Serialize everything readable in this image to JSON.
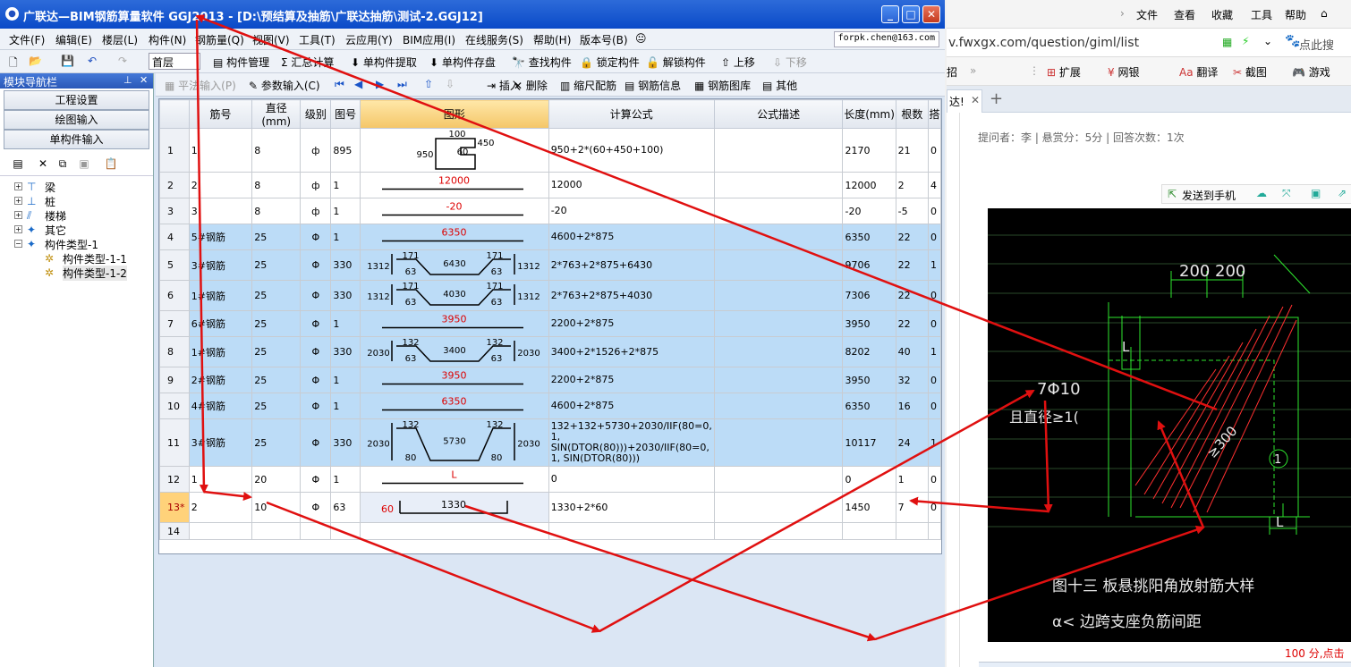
{
  "window": {
    "title": "广联达—BIM钢筋算量软件 GGJ2013 - [D:\\预结算及抽筋\\广联达抽筋\\测试-2.GGJ12]",
    "controls": {
      "minimize": "_",
      "maximize": "□",
      "close": "✕"
    }
  },
  "menu": [
    "文件(F)",
    "编辑(E)",
    "楼层(L)",
    "构件(N)",
    "钢筋量(Q)",
    "视图(V)",
    "工具(T)",
    "云应用(Y)",
    "BIM应用(I)",
    "在线服务(S)",
    "帮助(H)",
    "版本号(B)"
  ],
  "account": "forpk.chen@163.com",
  "toolbar1": {
    "floor": "首层",
    "buttons": [
      "构件管理",
      "汇总计算",
      "单构件提取",
      "单构件存盘",
      "查找构件",
      "锁定构件",
      "解锁构件",
      "上移",
      "下移"
    ]
  },
  "sidebar": {
    "title": "模块导航栏",
    "pin": "⊥",
    "close": "✕",
    "buttons": [
      "工程设置",
      "绘图输入",
      "单构件输入"
    ],
    "tree": [
      {
        "label": "梁",
        "level": 0,
        "expander": "+"
      },
      {
        "label": "桩",
        "level": 0,
        "expander": "+"
      },
      {
        "label": "楼梯",
        "level": 0,
        "expander": "+"
      },
      {
        "label": "其它",
        "level": 0,
        "expander": "+"
      },
      {
        "label": "构件类型-1",
        "level": 0,
        "expander": "−"
      },
      {
        "label": "构件类型-1-1",
        "level": 1
      },
      {
        "label": "构件类型-1-2",
        "level": 1
      }
    ]
  },
  "toolbar2": [
    "平法输入(P)",
    "参数输入(C)",
    "插入",
    "删除",
    "缩尺配筋",
    "钢筋信息",
    "钢筋图库",
    "其他"
  ],
  "grid": {
    "headers": [
      "",
      "筋号",
      "直径(mm)",
      "级别",
      "图号",
      "图形",
      "计算公式",
      "公式描述",
      "长度(mm)",
      "根数",
      "搭"
    ],
    "rows": [
      {
        "n": "1",
        "bar": "1",
        "dia": "8",
        "grade": "ф",
        "fig": "895",
        "formula": "950+2*(60+450+100)",
        "desc": "",
        "len": "2170",
        "cnt": "21",
        "lap": "0",
        "hl": false,
        "shape": {
          "kind": "stirrup",
          "t": [
            "100",
            "450",
            "950",
            "60"
          ]
        }
      },
      {
        "n": "2",
        "bar": "2",
        "dia": "8",
        "grade": "ф",
        "fig": "1",
        "formula": "12000",
        "desc": "",
        "len": "12000",
        "cnt": "2",
        "lap": "4",
        "hl": false,
        "shape": {
          "kind": "line",
          "t": [
            "12000"
          ]
        }
      },
      {
        "n": "3",
        "bar": "3",
        "dia": "8",
        "grade": "ф",
        "fig": "1",
        "formula": "-20",
        "desc": "",
        "len": "-20",
        "cnt": "-5",
        "lap": "0",
        "hl": false,
        "shape": {
          "kind": "line",
          "t": [
            "-20"
          ]
        }
      },
      {
        "n": "4",
        "bar": "5#钢筋",
        "dia": "25",
        "grade": "Φ",
        "fig": "1",
        "formula": "4600+2*875",
        "desc": "",
        "len": "6350",
        "cnt": "22",
        "lap": "0",
        "hl": true,
        "shape": {
          "kind": "line",
          "t": [
            "6350"
          ]
        }
      },
      {
        "n": "5",
        "bar": "3#钢筋",
        "dia": "25",
        "grade": "Φ",
        "fig": "330",
        "formula": "2*763+2*875+6430",
        "desc": "",
        "len": "9706",
        "cnt": "22",
        "lap": "1",
        "hl": true,
        "shape": {
          "kind": "bent",
          "t": [
            "171",
            "171",
            "1312",
            "63",
            "6430",
            "63",
            "1312"
          ]
        }
      },
      {
        "n": "6",
        "bar": "1#钢筋",
        "dia": "25",
        "grade": "Φ",
        "fig": "330",
        "formula": "2*763+2*875+4030",
        "desc": "",
        "len": "7306",
        "cnt": "22",
        "lap": "0",
        "hl": true,
        "shape": {
          "kind": "bent",
          "t": [
            "171",
            "171",
            "1312",
            "63",
            "4030",
            "63",
            "1312"
          ]
        }
      },
      {
        "n": "7",
        "bar": "6#钢筋",
        "dia": "25",
        "grade": "Φ",
        "fig": "1",
        "formula": "2200+2*875",
        "desc": "",
        "len": "3950",
        "cnt": "22",
        "lap": "0",
        "hl": true,
        "shape": {
          "kind": "line",
          "t": [
            "3950"
          ]
        }
      },
      {
        "n": "8",
        "bar": "1#钢筋",
        "dia": "25",
        "grade": "Φ",
        "fig": "330",
        "formula": "3400+2*1526+2*875",
        "desc": "",
        "len": "8202",
        "cnt": "40",
        "lap": "1",
        "hl": true,
        "shape": {
          "kind": "bent",
          "t": [
            "132",
            "132",
            "2030",
            "63",
            "3400",
            "63",
            "2030"
          ]
        }
      },
      {
        "n": "9",
        "bar": "2#钢筋",
        "dia": "25",
        "grade": "Φ",
        "fig": "1",
        "formula": "2200+2*875",
        "desc": "",
        "len": "3950",
        "cnt": "32",
        "lap": "0",
        "hl": true,
        "shape": {
          "kind": "line",
          "t": [
            "3950"
          ]
        }
      },
      {
        "n": "10",
        "bar": "4#钢筋",
        "dia": "25",
        "grade": "Φ",
        "fig": "1",
        "formula": "4600+2*875",
        "desc": "",
        "len": "6350",
        "cnt": "16",
        "lap": "0",
        "hl": true,
        "shape": {
          "kind": "line",
          "t": [
            "6350"
          ]
        }
      },
      {
        "n": "11",
        "bar": "3#钢筋",
        "dia": "25",
        "grade": "Φ",
        "fig": "330",
        "formula": "132+132+5730+2030/IIF(80=0, 1, SIN(DTOR(80)))+2030/IIF(80=0, 1, SIN(DTOR(80)))",
        "desc": "",
        "len": "10117",
        "cnt": "24",
        "lap": "1",
        "hl": true,
        "shape": {
          "kind": "bent",
          "t": [
            "132",
            "132",
            "2030",
            "80",
            "5730",
            "80",
            "2030"
          ]
        }
      },
      {
        "n": "12",
        "bar": "1",
        "dia": "20",
        "grade": "Φ",
        "fig": "1",
        "formula": "0",
        "desc": "",
        "len": "0",
        "cnt": "1",
        "lap": "0",
        "hl": false,
        "shape": {
          "kind": "line",
          "t": [
            "L"
          ]
        }
      },
      {
        "n": "13*",
        "bar": "2",
        "dia": "10",
        "grade": "Φ",
        "fig": "63",
        "formula": "1330+2*60",
        "desc": "",
        "len": "1450",
        "cnt": "7",
        "lap": "0",
        "hl": false,
        "cur": true,
        "shape": {
          "kind": "ushape",
          "t": [
            "60",
            "1330"
          ]
        }
      },
      {
        "n": "14",
        "bar": "",
        "dia": "",
        "grade": "",
        "fig": "",
        "formula": "",
        "desc": "",
        "len": "",
        "cnt": "",
        "lap": "",
        "hl": false,
        "shape": {
          "kind": "none",
          "t": []
        }
      }
    ]
  },
  "browser": {
    "menu": [
      "文件",
      "查看",
      "收藏",
      "工具",
      "帮助"
    ],
    "url": "v.fwxgx.com/question/giml/list",
    "url_right": "点此搜",
    "ext_left": "招",
    "ext": [
      "扩展",
      "网银",
      "翻译",
      "截图",
      "游戏"
    ],
    "tab": "达!",
    "meta": "提问者：李   |   悬赏分：5分   |   回答次数：1次",
    "send": "发送到手机",
    "cad": {
      "dims": [
        "200",
        "200"
      ],
      "label_a": "7Φ10",
      "label_b": "且直径≥1(",
      "label_c": "≥300",
      "circle": "1",
      "L": "L",
      "caption1": "图十三   板悬挑阳角放射筋大样",
      "caption2": "α< 边跨支座负筋间距"
    },
    "footer": "100 分,点击"
  },
  "colors": {
    "highlight_row": "#bcdcf7",
    "current_row": "#ffd27a",
    "annotation": "#e01010",
    "dim_text": "#d00000"
  }
}
